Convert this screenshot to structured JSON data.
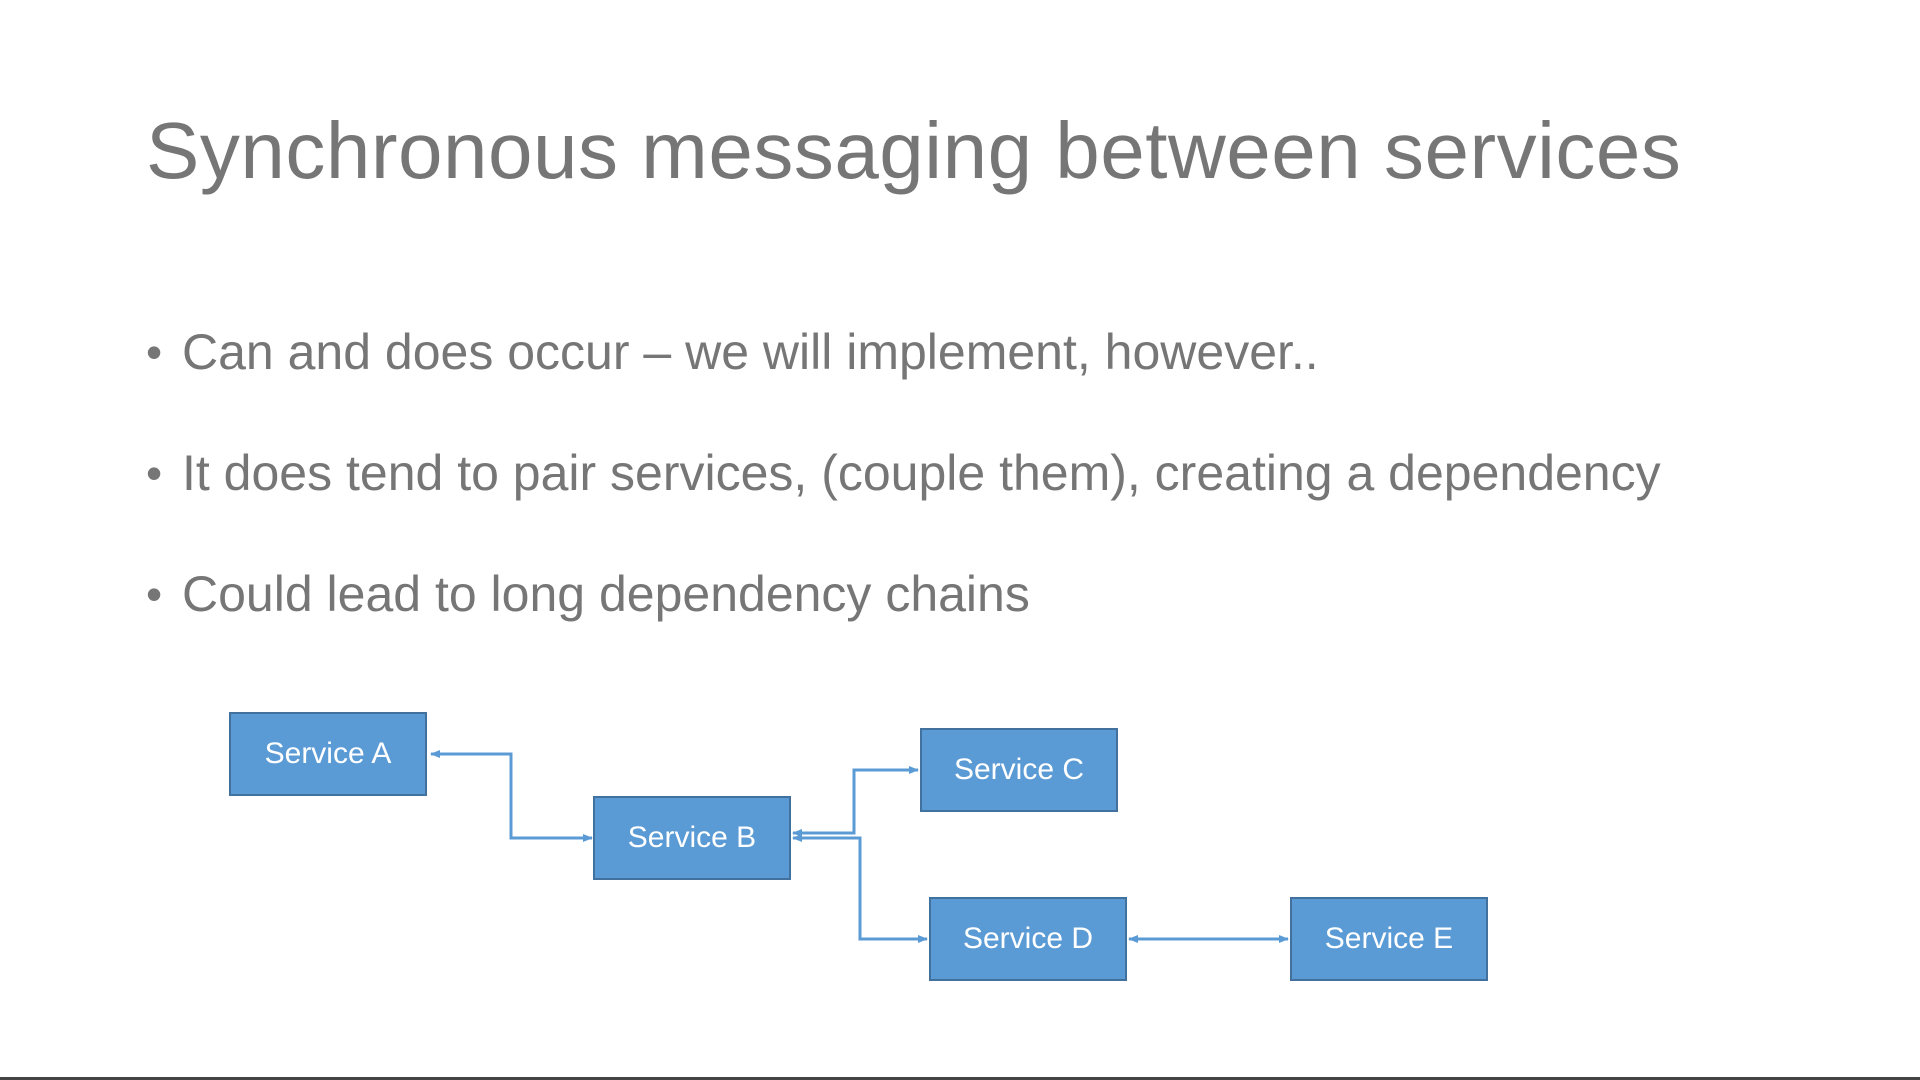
{
  "slide": {
    "title": "Synchronous messaging between services",
    "bullets": [
      "Can and does occur – we will implement, however..",
      "It does tend to pair services, (couple them), creating a dependency",
      "Could lead to long dependency chains"
    ],
    "bullet_glyph": "•"
  },
  "diagram": {
    "nodes": {
      "a": "Service A",
      "b": "Service B",
      "c": "Service C",
      "d": "Service D",
      "e": "Service E"
    },
    "connections": [
      {
        "from": "Service A",
        "to": "Service B",
        "direction": "bidirectional"
      },
      {
        "from": "Service B",
        "to": "Service C",
        "direction": "bidirectional"
      },
      {
        "from": "Service B",
        "to": "Service D",
        "direction": "bidirectional"
      },
      {
        "from": "Service D",
        "to": "Service E",
        "direction": "bidirectional"
      }
    ],
    "colors": {
      "box_fill": "#5b9bd5",
      "box_border": "#41719c",
      "connector": "#5b9bd5",
      "text": "#767676"
    }
  }
}
